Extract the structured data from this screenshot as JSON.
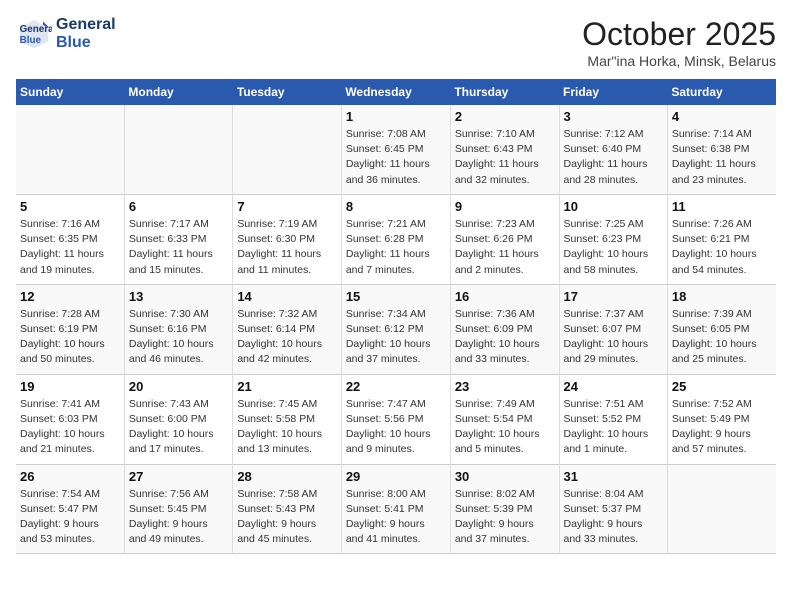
{
  "header": {
    "logo_line1": "General",
    "logo_line2": "Blue",
    "title": "October 2025",
    "subtitle": "Mar\"ina Horka, Minsk, Belarus"
  },
  "weekdays": [
    "Sunday",
    "Monday",
    "Tuesday",
    "Wednesday",
    "Thursday",
    "Friday",
    "Saturday"
  ],
  "rows": [
    [
      {
        "num": "",
        "info": ""
      },
      {
        "num": "",
        "info": ""
      },
      {
        "num": "",
        "info": ""
      },
      {
        "num": "1",
        "info": "Sunrise: 7:08 AM\nSunset: 6:45 PM\nDaylight: 11 hours\nand 36 minutes."
      },
      {
        "num": "2",
        "info": "Sunrise: 7:10 AM\nSunset: 6:43 PM\nDaylight: 11 hours\nand 32 minutes."
      },
      {
        "num": "3",
        "info": "Sunrise: 7:12 AM\nSunset: 6:40 PM\nDaylight: 11 hours\nand 28 minutes."
      },
      {
        "num": "4",
        "info": "Sunrise: 7:14 AM\nSunset: 6:38 PM\nDaylight: 11 hours\nand 23 minutes."
      }
    ],
    [
      {
        "num": "5",
        "info": "Sunrise: 7:16 AM\nSunset: 6:35 PM\nDaylight: 11 hours\nand 19 minutes."
      },
      {
        "num": "6",
        "info": "Sunrise: 7:17 AM\nSunset: 6:33 PM\nDaylight: 11 hours\nand 15 minutes."
      },
      {
        "num": "7",
        "info": "Sunrise: 7:19 AM\nSunset: 6:30 PM\nDaylight: 11 hours\nand 11 minutes."
      },
      {
        "num": "8",
        "info": "Sunrise: 7:21 AM\nSunset: 6:28 PM\nDaylight: 11 hours\nand 7 minutes."
      },
      {
        "num": "9",
        "info": "Sunrise: 7:23 AM\nSunset: 6:26 PM\nDaylight: 11 hours\nand 2 minutes."
      },
      {
        "num": "10",
        "info": "Sunrise: 7:25 AM\nSunset: 6:23 PM\nDaylight: 10 hours\nand 58 minutes."
      },
      {
        "num": "11",
        "info": "Sunrise: 7:26 AM\nSunset: 6:21 PM\nDaylight: 10 hours\nand 54 minutes."
      }
    ],
    [
      {
        "num": "12",
        "info": "Sunrise: 7:28 AM\nSunset: 6:19 PM\nDaylight: 10 hours\nand 50 minutes."
      },
      {
        "num": "13",
        "info": "Sunrise: 7:30 AM\nSunset: 6:16 PM\nDaylight: 10 hours\nand 46 minutes."
      },
      {
        "num": "14",
        "info": "Sunrise: 7:32 AM\nSunset: 6:14 PM\nDaylight: 10 hours\nand 42 minutes."
      },
      {
        "num": "15",
        "info": "Sunrise: 7:34 AM\nSunset: 6:12 PM\nDaylight: 10 hours\nand 37 minutes."
      },
      {
        "num": "16",
        "info": "Sunrise: 7:36 AM\nSunset: 6:09 PM\nDaylight: 10 hours\nand 33 minutes."
      },
      {
        "num": "17",
        "info": "Sunrise: 7:37 AM\nSunset: 6:07 PM\nDaylight: 10 hours\nand 29 minutes."
      },
      {
        "num": "18",
        "info": "Sunrise: 7:39 AM\nSunset: 6:05 PM\nDaylight: 10 hours\nand 25 minutes."
      }
    ],
    [
      {
        "num": "19",
        "info": "Sunrise: 7:41 AM\nSunset: 6:03 PM\nDaylight: 10 hours\nand 21 minutes."
      },
      {
        "num": "20",
        "info": "Sunrise: 7:43 AM\nSunset: 6:00 PM\nDaylight: 10 hours\nand 17 minutes."
      },
      {
        "num": "21",
        "info": "Sunrise: 7:45 AM\nSunset: 5:58 PM\nDaylight: 10 hours\nand 13 minutes."
      },
      {
        "num": "22",
        "info": "Sunrise: 7:47 AM\nSunset: 5:56 PM\nDaylight: 10 hours\nand 9 minutes."
      },
      {
        "num": "23",
        "info": "Sunrise: 7:49 AM\nSunset: 5:54 PM\nDaylight: 10 hours\nand 5 minutes."
      },
      {
        "num": "24",
        "info": "Sunrise: 7:51 AM\nSunset: 5:52 PM\nDaylight: 10 hours\nand 1 minute."
      },
      {
        "num": "25",
        "info": "Sunrise: 7:52 AM\nSunset: 5:49 PM\nDaylight: 9 hours\nand 57 minutes."
      }
    ],
    [
      {
        "num": "26",
        "info": "Sunrise: 7:54 AM\nSunset: 5:47 PM\nDaylight: 9 hours\nand 53 minutes."
      },
      {
        "num": "27",
        "info": "Sunrise: 7:56 AM\nSunset: 5:45 PM\nDaylight: 9 hours\nand 49 minutes."
      },
      {
        "num": "28",
        "info": "Sunrise: 7:58 AM\nSunset: 5:43 PM\nDaylight: 9 hours\nand 45 minutes."
      },
      {
        "num": "29",
        "info": "Sunrise: 8:00 AM\nSunset: 5:41 PM\nDaylight: 9 hours\nand 41 minutes."
      },
      {
        "num": "30",
        "info": "Sunrise: 8:02 AM\nSunset: 5:39 PM\nDaylight: 9 hours\nand 37 minutes."
      },
      {
        "num": "31",
        "info": "Sunrise: 8:04 AM\nSunset: 5:37 PM\nDaylight: 9 hours\nand 33 minutes."
      },
      {
        "num": "",
        "info": ""
      }
    ]
  ]
}
